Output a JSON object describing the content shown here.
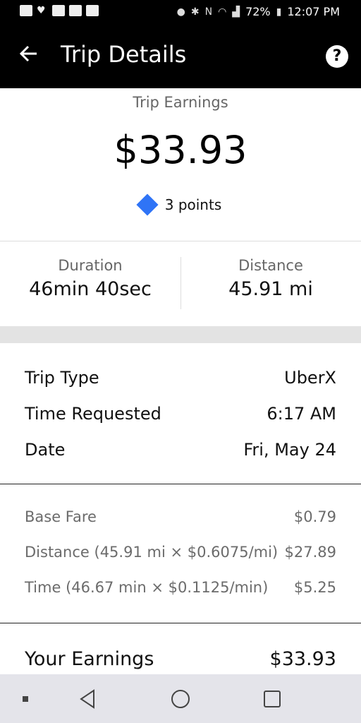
{
  "status_bar": {
    "battery": "72%",
    "time": "12:07 PM"
  },
  "header": {
    "title": "Trip Details",
    "back_icon": "arrow-left-icon",
    "help_icon": "question-circle-icon"
  },
  "earnings": {
    "label": "Trip Earnings",
    "amount": "$33.93",
    "points": "3 points",
    "points_color": "#2f74f6"
  },
  "stats": {
    "duration_label": "Duration",
    "duration_value": "46min 40sec",
    "distance_label": "Distance",
    "distance_value": "45.91 mi"
  },
  "details": [
    {
      "label": "Trip Type",
      "value": "UberX"
    },
    {
      "label": "Time Requested",
      "value": "6:17 AM"
    },
    {
      "label": "Date",
      "value": "Fri, May 24"
    }
  ],
  "fare": [
    {
      "label": "Base Fare",
      "value": "$0.79"
    },
    {
      "label": "Distance (45.91 mi × $0.6075/mi)",
      "value": "$27.89"
    },
    {
      "label": "Time (46.67 min × $0.1125/min)",
      "value": "$5.25"
    }
  ],
  "total": {
    "label": "Your Earnings",
    "value": "$33.93"
  },
  "nav": {
    "items": [
      "recent-apps-dot-icon",
      "back-triangle-icon",
      "home-circle-icon",
      "overview-square-icon"
    ]
  }
}
